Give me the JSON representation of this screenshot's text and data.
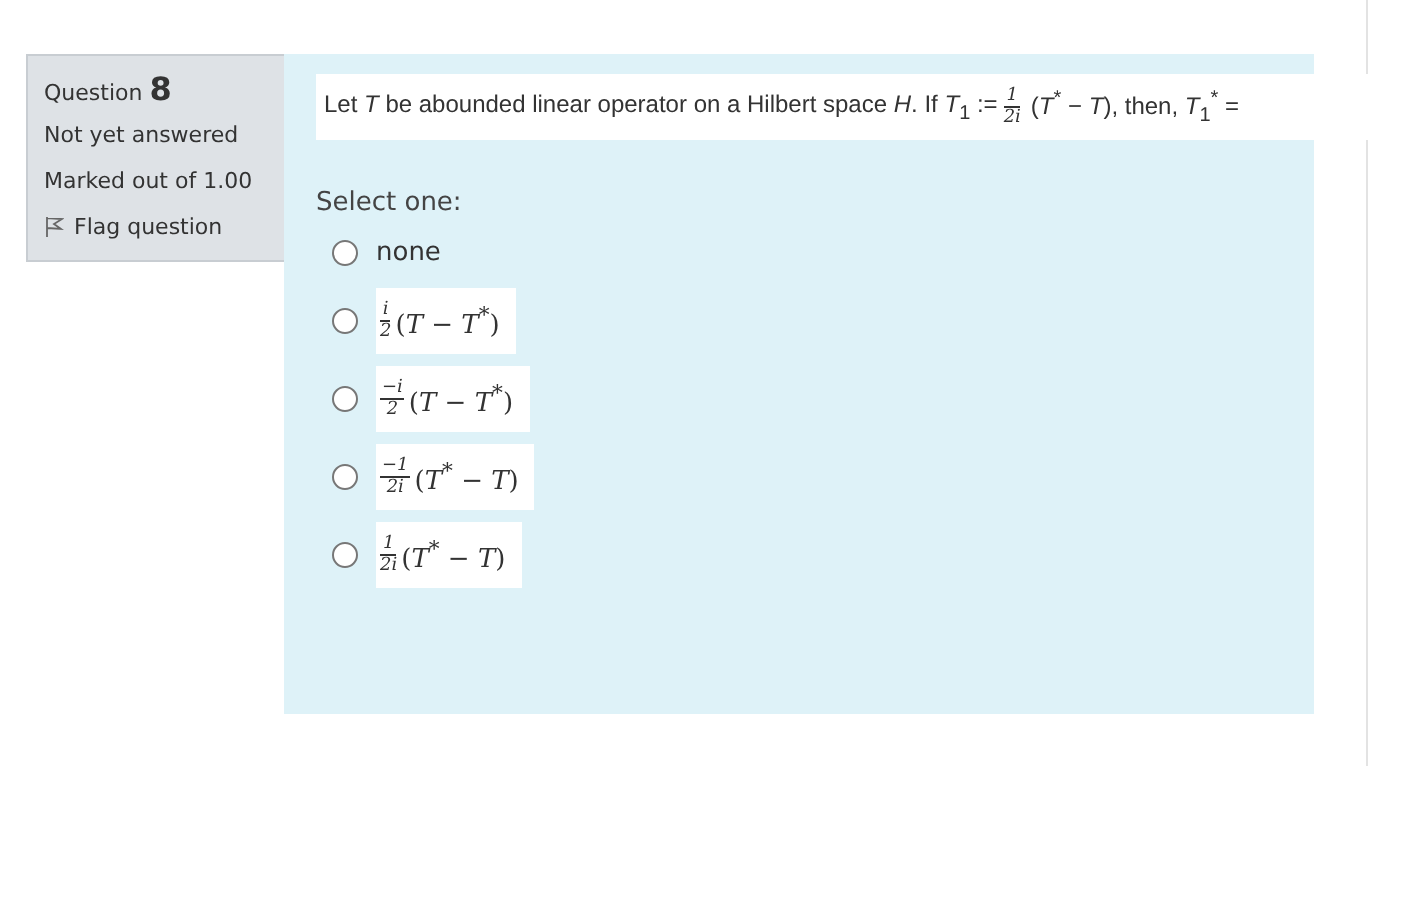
{
  "info": {
    "question_label": "Question",
    "question_number": "8",
    "status": "Not yet answered",
    "marks": "Marked out of 1.00",
    "flag": "Flag question"
  },
  "question": {
    "parts": [
      {
        "kind": "text",
        "text": "Let *T* be abounded linear operator on a Hilbert space *H*. If *T*$_{1}$ :="
      },
      {
        "kind": "frac",
        "num": "1",
        "den": "2i"
      },
      {
        "kind": "text",
        "text": "(*T*$^{*}$ − *T*), then, *T*$_{1}$$^{*}$ ="
      }
    ]
  },
  "prompt": "Select one:",
  "options": [
    {
      "kind": "text",
      "label": "none",
      "selected": false
    },
    {
      "kind": "math",
      "num": "i",
      "den": "2",
      "expr": "(*T* − *T*$^{*}$)",
      "selected": false
    },
    {
      "kind": "math",
      "num": "−i",
      "den": "2",
      "expr": "(*T* − *T*$^{*}$)",
      "selected": false
    },
    {
      "kind": "math",
      "num": "−1",
      "den": "2i",
      "expr": "(*T*$^{*}$ − *T*)",
      "selected": false
    },
    {
      "kind": "math",
      "num": "1",
      "den": "2i",
      "expr": "(*T*$^{*}$ − *T*)",
      "selected": false
    }
  ]
}
